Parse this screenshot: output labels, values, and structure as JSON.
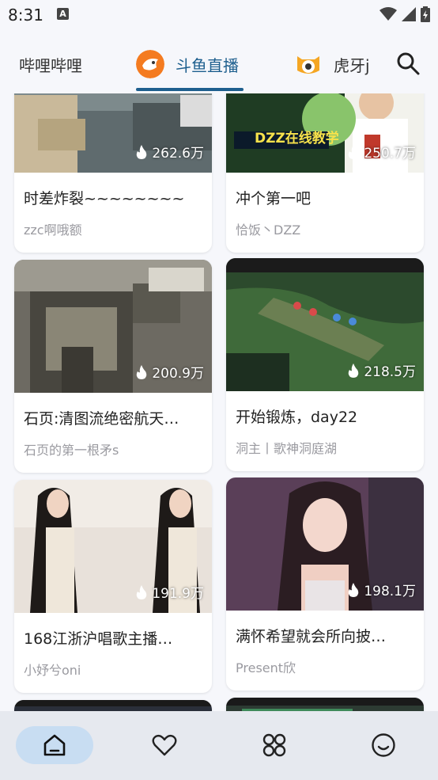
{
  "status_bar": {
    "time": "8:31",
    "notification_badge": "A"
  },
  "tabs": [
    {
      "label": "哔哩哔哩",
      "active": false
    },
    {
      "label": "斗鱼直播",
      "active": true
    },
    {
      "label": "虎牙j",
      "active": false
    }
  ],
  "colors": {
    "accent": "#1e5f8e",
    "douyu_orange": "#f47b20",
    "huya_yellow": "#f5a623",
    "nav_active": "#c8ddf2"
  },
  "feed": {
    "cards": [
      {
        "heat": "262.6万",
        "title": "时差炸裂~~~~~~~~",
        "author": "zzc啊哦额",
        "thumb_overlay_text": ""
      },
      {
        "heat": "250.7万",
        "title": "冲个第一吧",
        "author": "恰饭丶DZZ",
        "thumb_overlay_text": "DZZ在线教学"
      },
      {
        "heat": "200.9万",
        "title": "石页:清图流绝密航天…",
        "author": "石页的第一根矛s",
        "thumb_overlay_text": ""
      },
      {
        "heat": "218.5万",
        "title": "开始锻炼，day22",
        "author": "洞主丨歌神洞庭湖",
        "thumb_overlay_text": ""
      },
      {
        "heat": "191.9万",
        "title": "168江浙沪唱歌主播…",
        "author": "小妤兮oni",
        "thumb_overlay_text": ""
      },
      {
        "heat": "198.1万",
        "title": "满怀希望就会所向披…",
        "author": "Present欣",
        "thumb_overlay_text": ""
      }
    ]
  },
  "bottom_nav": [
    {
      "icon": "home-icon",
      "active": true
    },
    {
      "icon": "heart-icon",
      "active": false
    },
    {
      "icon": "apps-icon",
      "active": false
    },
    {
      "icon": "smile-icon",
      "active": false
    }
  ]
}
